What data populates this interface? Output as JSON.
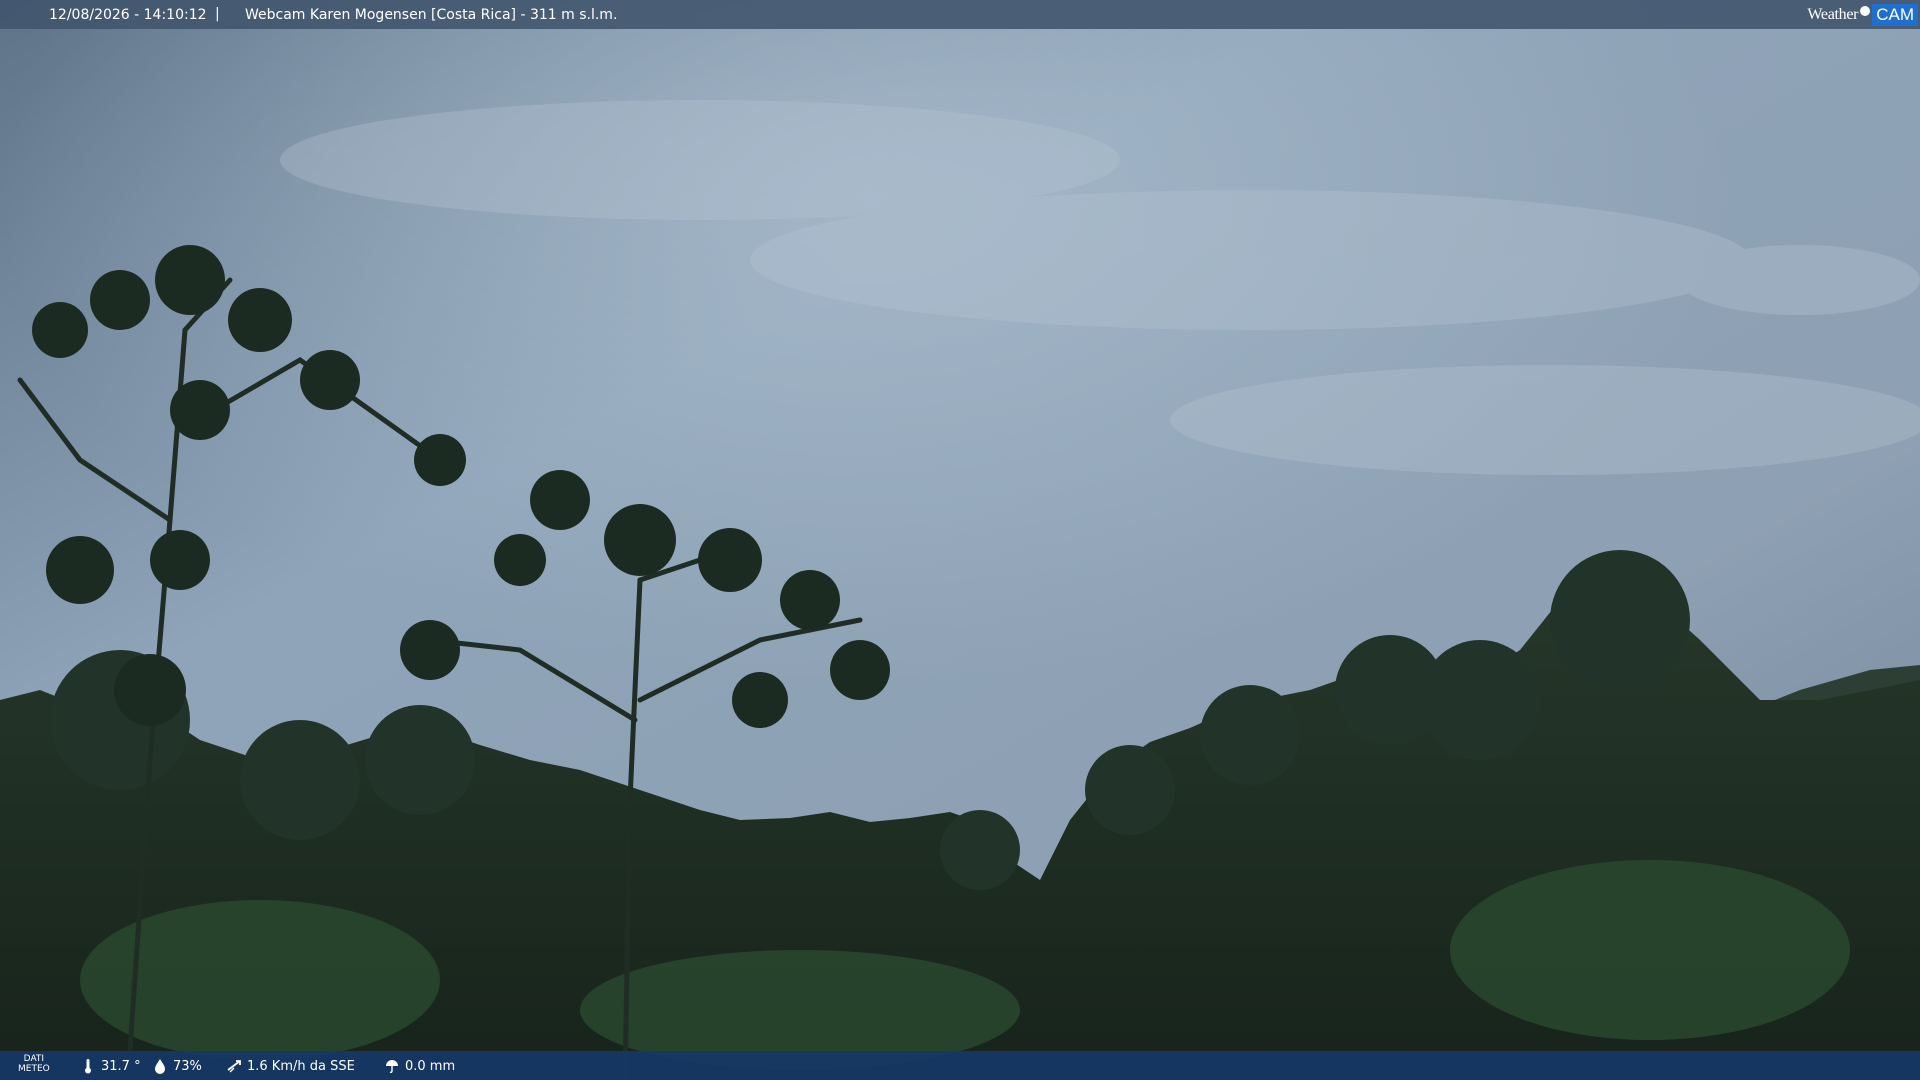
{
  "header": {
    "timestamp": "12/08/2026 - 14:10:12",
    "separator": "|",
    "title": "Webcam Karen Mogensen [Costa Rica] - 311 m s.l.m.",
    "logo": {
      "weather": "Weather",
      "cam": "CAM"
    }
  },
  "footer": {
    "dati_line1": "DATI",
    "dati_line2": "METEO",
    "temperature": "31.7 °",
    "humidity": "73%",
    "wind": "1.6 Km/h da SSE",
    "rain": "0.0 mm"
  },
  "colors": {
    "sky": "#8ea3b8",
    "foliage": "#1d2c20",
    "header_bar": "#40546c",
    "footer_bar": "#163866",
    "logo_accent": "#1f6fd0"
  }
}
